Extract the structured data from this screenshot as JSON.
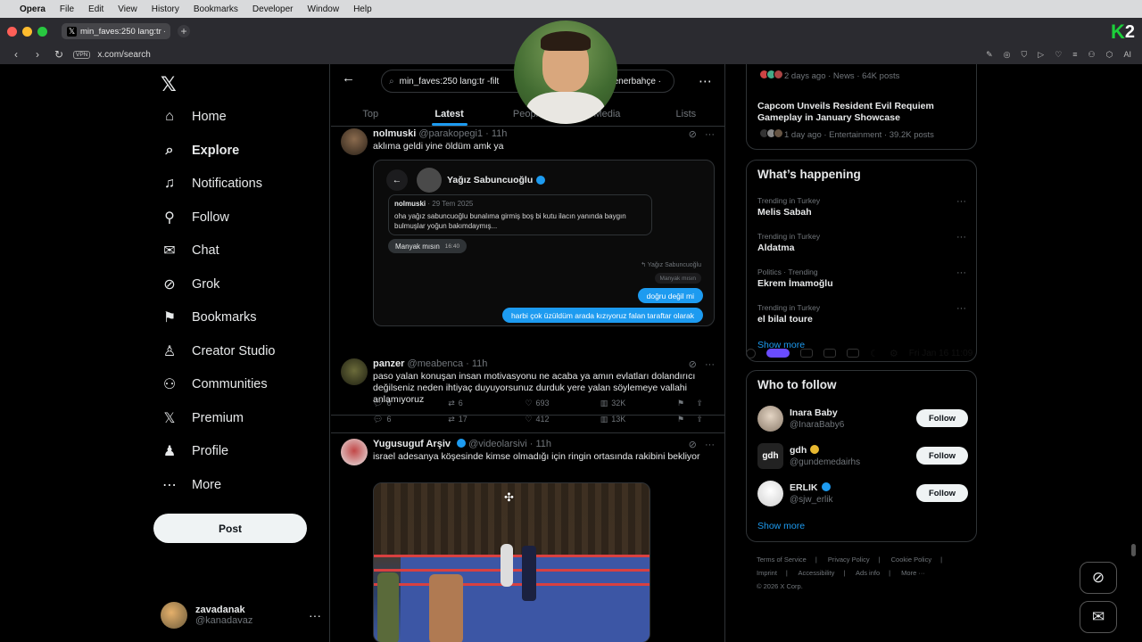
{
  "menubar": {
    "app": "Opera",
    "items": [
      "File",
      "Edit",
      "View",
      "History",
      "Bookmarks",
      "Developer",
      "Window",
      "Help"
    ],
    "clock": "Fri Jan 16  11:09"
  },
  "browser": {
    "tab_title": "min_faves:250 lang:tr -fi",
    "url": "x.com/search",
    "vpn_label": "VPN",
    "ai_label": "AI",
    "k2_label": "2"
  },
  "sidebar": {
    "nav": [
      {
        "label": "Home",
        "icon": "home-icon"
      },
      {
        "label": "Explore",
        "icon": "search-icon"
      },
      {
        "label": "Notifications",
        "icon": "bell-icon"
      },
      {
        "label": "Follow",
        "icon": "follow-icon"
      },
      {
        "label": "Chat",
        "icon": "mail-icon"
      },
      {
        "label": "Grok",
        "icon": "grok-icon"
      },
      {
        "label": "Bookmarks",
        "icon": "bookmark-icon"
      },
      {
        "label": "Creator Studio",
        "icon": "creator-studio-icon"
      },
      {
        "label": "Communities",
        "icon": "communities-icon"
      },
      {
        "label": "Premium",
        "icon": "x-logo-icon"
      },
      {
        "label": "Profile",
        "icon": "person-icon"
      },
      {
        "label": "More",
        "icon": "more-icon"
      }
    ],
    "post_label": "Post",
    "account": {
      "name": "zavadanak",
      "handle": "@kanadavaz"
    }
  },
  "search": {
    "query_left": "min_faves:250 lang:tr -filt",
    "query_right": "enerbahçe ·"
  },
  "tabs": [
    "Top",
    "Latest",
    "People",
    "Media",
    "Lists"
  ],
  "tweets": [
    {
      "name": "nolmuski",
      "handle": "@parakopegi1",
      "time": "11h",
      "text": "aklıma geldi yine öldüm amk ya",
      "replies": "6",
      "reposts": "6",
      "likes": "693",
      "views": "32K",
      "card": {
        "header_name": "Yağız Sabuncuoğlu",
        "quote_name": "nolmuski",
        "quote_date": "29 Tem 2025",
        "quote_text": "oha yağız sabuncuoğlu bunalıma girmiş boş bi kutu ilacın yanında baygın bulmuşlar yoğun bakımdaymış...",
        "gray_bubble": "Manyak mısın",
        "gray_time": "16:40",
        "reply_label": "↰ Yağız Sabuncuoğlu",
        "reply_ghost": "Manyak mısın",
        "blue_1": "doğru değil mi",
        "blue_2": "harbi çok üzüldüm arada kızıyoruz falan taraftar olarak"
      }
    },
    {
      "name": "panzer",
      "handle": "@meabenca",
      "time": "11h",
      "text": "paso yalan konuşan insan motivasyonu ne acaba ya amın evlatları dolandırıcı değilseniz neden ihtiyaç duyuyorsunuz durduk yere yalan söylemeye vallahi anlamıyoruz",
      "replies": "6",
      "reposts": "17",
      "likes": "412",
      "views": "13K"
    },
    {
      "name": "Yugusuguf Arşiv",
      "handle": "@videolarsivi",
      "time": "11h",
      "text": "israel adesanya köşesinde kimse olmadığı için ringin ortasında rakibini bekliyor"
    }
  ],
  "right": {
    "top_meta": "2 days ago · News · 64K posts",
    "top_headline": "Capcom Unveils Resident Evil Requiem Gameplay in January Showcase",
    "top_meta2": "1 day ago · Entertainment · 39.2K posts",
    "happening_title": "What’s happening",
    "trends": [
      {
        "context": "Trending in Turkey",
        "title": "Melis Sabah"
      },
      {
        "context": "Trending in Turkey",
        "title": "Aldatma"
      },
      {
        "context": "Politics · Trending",
        "title": "Ekrem İmamoğlu"
      },
      {
        "context": "Trending in Turkey",
        "title": "el bilal toure"
      }
    ],
    "show_more": "Show more",
    "wtf_title": "Who to follow",
    "who_to_follow": [
      {
        "name": "Inara Baby",
        "handle": "@InaraBaby6",
        "button": "Follow"
      },
      {
        "name": "gdh",
        "handle": "@gundemedairhs",
        "button": "Follow",
        "avatar_text": "gdh"
      },
      {
        "name": "ERLIK",
        "handle": "@sjw_erlik",
        "button": "Follow"
      }
    ],
    "footer": [
      "Terms of Service",
      "|",
      "Privacy Policy",
      "|",
      "Cookie Policy",
      "|",
      "Imprint",
      "|",
      "Accessibility",
      "|",
      "Ads info",
      "|",
      "More ···",
      "© 2026 X Corp."
    ]
  },
  "colors": {
    "accent": "#1d9bf0",
    "background": "#000000",
    "border": "#2f3336",
    "muted": "#71767b"
  }
}
